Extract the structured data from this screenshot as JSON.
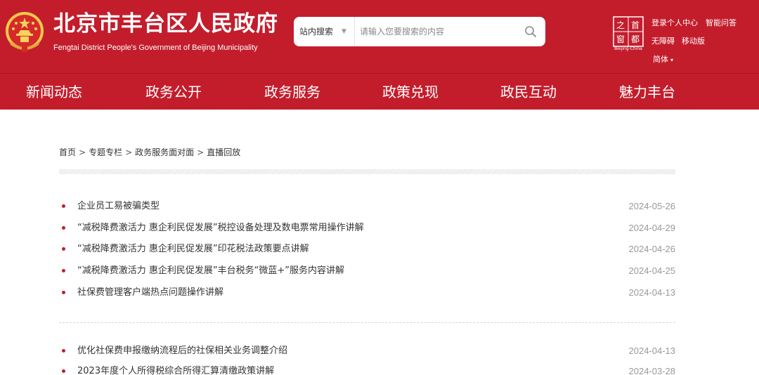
{
  "site": {
    "title": "北京市丰台区人民政府",
    "subtitle": "Fengtai District People's Government of Beijing Municipality"
  },
  "search": {
    "scope_label": "站内搜索",
    "placeholder": "请输入您要搜索的内容"
  },
  "capital_logo": {
    "chars": [
      "首",
      "都",
      "之",
      "窗"
    ],
    "caption": "Beijing-China"
  },
  "top_links": {
    "login": "登录个人中心",
    "qa": "智能问答",
    "accessible": "无障碍",
    "mobile": "移动版",
    "language": "简体"
  },
  "nav": {
    "items": [
      {
        "label": "新闻动态"
      },
      {
        "label": "政务公开"
      },
      {
        "label": "政务服务"
      },
      {
        "label": "政策兑现"
      },
      {
        "label": "政民互动"
      },
      {
        "label": "魅力丰台"
      }
    ]
  },
  "breadcrumb": {
    "items": [
      "首页",
      "专题专栏",
      "政务服务面对面",
      "直播回放"
    ],
    "separator": ">"
  },
  "news": {
    "items": [
      {
        "title": "企业员工易被骗类型",
        "date": "2024-05-26"
      },
      {
        "title": "“减税降费激活力 惠企利民促发展”税控设备处理及数电票常用操作讲解",
        "date": "2024-04-29"
      },
      {
        "title": "“减税降费激活力 惠企利民促发展”印花税法政策要点讲解",
        "date": "2024-04-26"
      },
      {
        "title": "“减税降费激活力 惠企利民促发展”丰台税务“微蓝+”服务内容讲解",
        "date": "2024-04-25"
      },
      {
        "title": "社保费管理客户端热点问题操作讲解",
        "date": "2024-04-13"
      },
      {
        "title": "优化社保费申报缴纳流程后的社保相关业务调整介绍",
        "date": "2024-04-13"
      },
      {
        "title": "2023年度个人所得税综合所得汇算清缴政策讲解",
        "date": "2024-03-28"
      }
    ]
  },
  "colors": {
    "brand_red": "#c31d2c",
    "bullet": "#c31d2c",
    "date_text": "#999999",
    "body_text": "#333333"
  },
  "icons": {
    "emblem": "national-emblem-icon",
    "search": "search-icon",
    "scope_dropdown": "chevron-down-icon",
    "capital_logo": "capital-window-logo"
  }
}
